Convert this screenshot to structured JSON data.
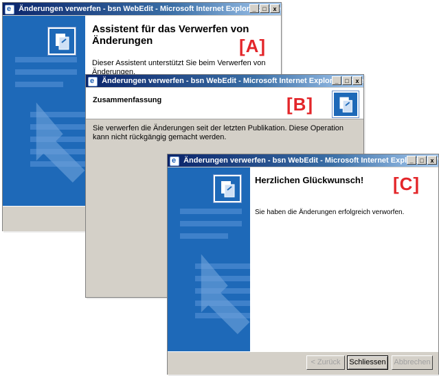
{
  "window_a": {
    "title": "Änderungen verwerfen - bsn WebEdit - Microsoft Internet Explorer  zur Verfügung ge...",
    "heading": "Assistent für das Verwerfen von Änderungen",
    "body": "Dieser Assistent unterstützt Sie beim Verwerfen von Änderungen.",
    "tag": "[A]"
  },
  "window_b": {
    "title": "Änderungen verwerfen - bsn WebEdit - Microsoft Internet Explorer  zur Verfügung ge...",
    "heading": "Zusammenfassung",
    "body": "Sie verwerfen die Änderungen seit der letzten Publikation. Diese Operation kann nicht rückgängig gemacht werden.",
    "tag": "[B]"
  },
  "window_c": {
    "title": "Änderungen verwerfen - bsn WebEdit - Microsoft Internet Explorer  zur Verfügung ge...",
    "heading": "Herzlichen Glückwunsch!",
    "body": "Sie haben die Änderungen erfolgreich verworfen.",
    "tag": "[C]",
    "buttons": {
      "back": "< Zurück",
      "close": "Schliessen",
      "cancel": "Abbrechen"
    }
  },
  "controls": {
    "minimize": "_",
    "maximize": "□",
    "close": "x"
  },
  "colors": {
    "titlebar_start": "#0a246a",
    "titlebar_end": "#a6caf0",
    "panel_blue": "#1e69b8",
    "tag_red": "#e3262a"
  }
}
